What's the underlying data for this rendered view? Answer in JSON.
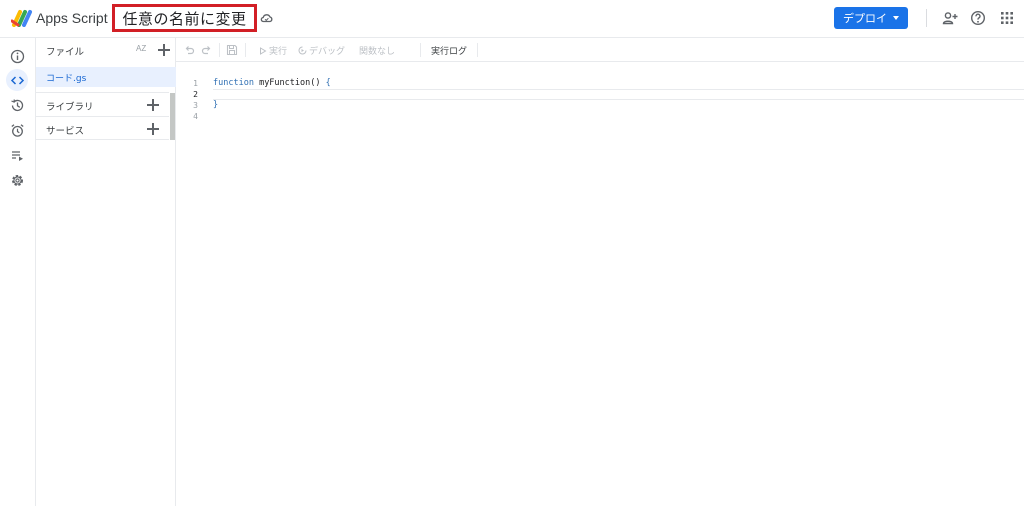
{
  "header": {
    "app_name": "Apps Script",
    "project_title": "任意の名前に変更",
    "deploy_label": "デプロイ",
    "accent_color": "#1a73e8",
    "highlight_color": "#d21f26"
  },
  "rail": {
    "items": [
      {
        "icon": "info-icon"
      },
      {
        "icon": "code-icon",
        "active": true
      },
      {
        "icon": "history-icon"
      },
      {
        "icon": "alarm-icon"
      },
      {
        "icon": "executions-icon"
      },
      {
        "icon": "gear-icon"
      }
    ]
  },
  "files": {
    "label": "ファイル",
    "sort_label": "AZ",
    "items": [
      {
        "name": "コード.gs"
      }
    ],
    "sections": [
      {
        "label": "ライブラリ"
      },
      {
        "label": "サービス"
      }
    ]
  },
  "toolbar": {
    "run_label": "実行",
    "debug_label": "デバッグ",
    "function_label": "関数なし",
    "log_label": "実行ログ"
  },
  "editor": {
    "line_numbers": [
      "1",
      "2",
      "3",
      "4"
    ],
    "code": {
      "keyword": "function",
      "name": " myFunction() ",
      "open_brace": "{",
      "close_brace": "}"
    }
  }
}
